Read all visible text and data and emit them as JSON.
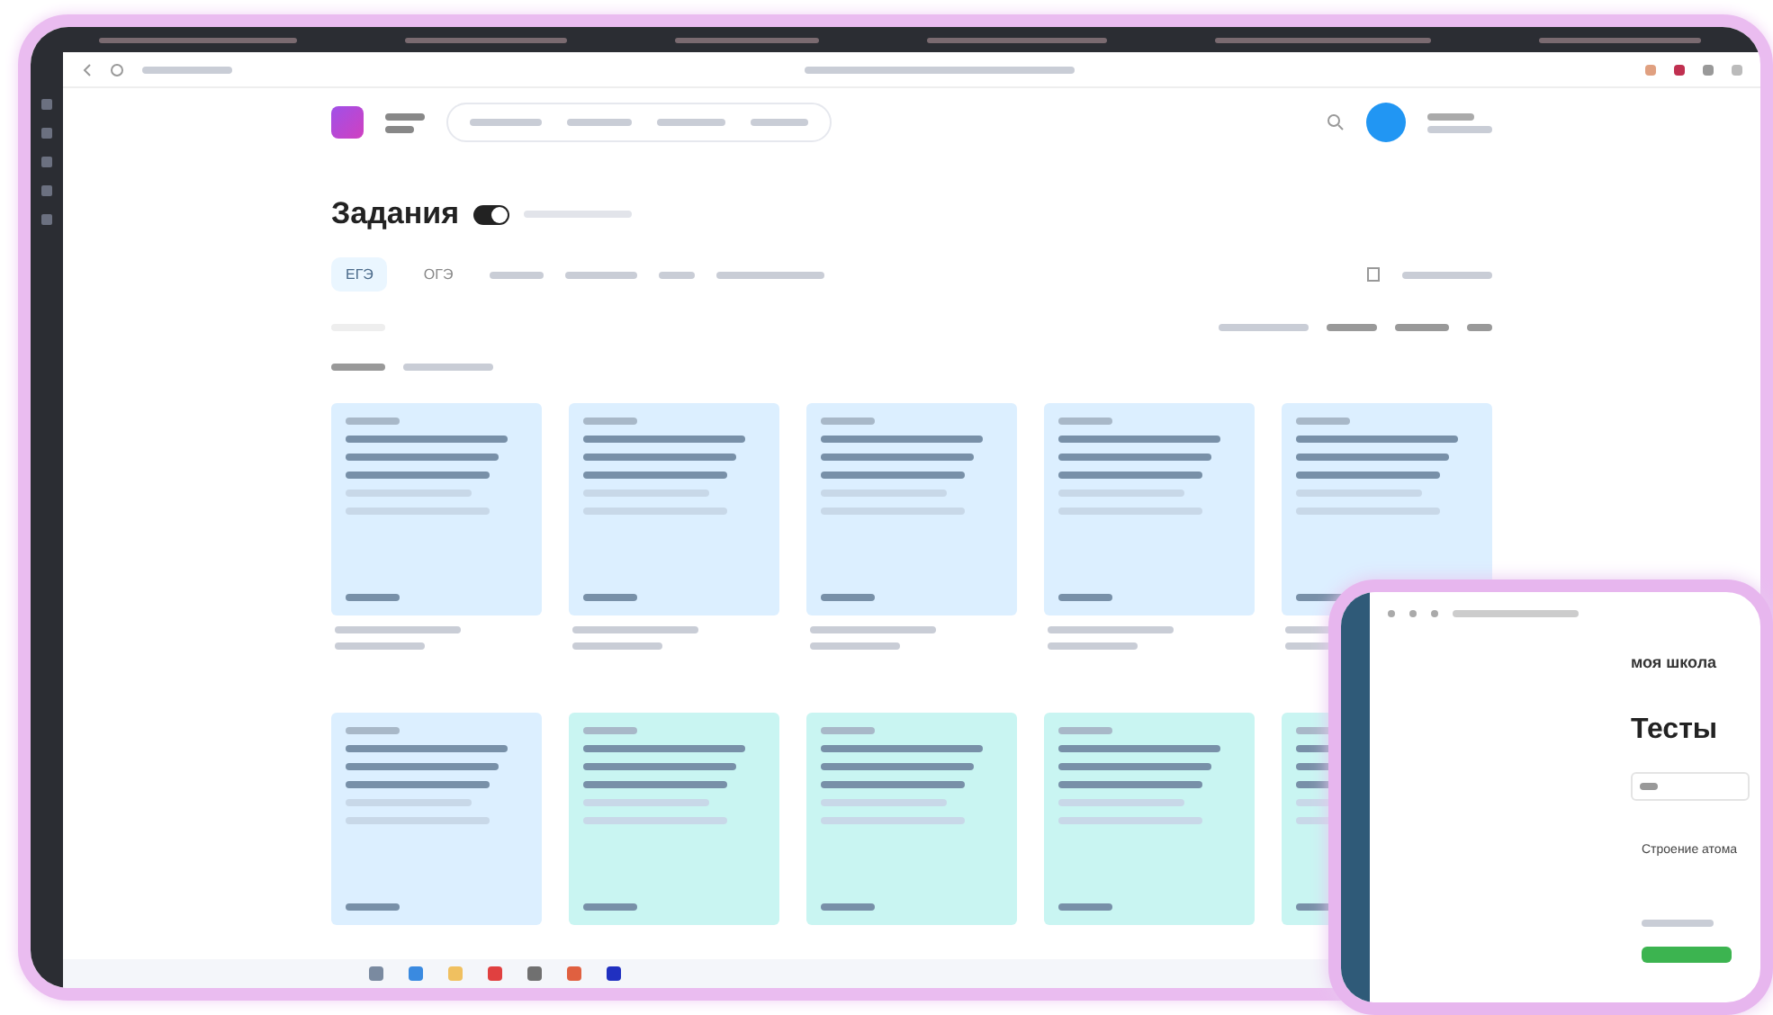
{
  "main_window": {
    "page": {
      "title": "Задания",
      "toggle": {
        "on": true
      },
      "exam_tabs": [
        {
          "label": "ЕГЭ",
          "selected": true
        },
        {
          "label": "ОГЭ",
          "selected": false
        }
      ],
      "cards": [
        {
          "color": "#dcefff"
        },
        {
          "color": "#dcefff"
        },
        {
          "color": "#dcefff"
        },
        {
          "color": "#dcefff"
        },
        {
          "color": "#dcefff"
        },
        {
          "color": "#dcefff"
        },
        {
          "color": "#c9f5f2"
        },
        {
          "color": "#c9f5f2"
        },
        {
          "color": "#c9f5f2"
        },
        {
          "color": "#c9f5f2"
        }
      ]
    }
  },
  "second_window": {
    "brand": "моя школа",
    "title": "Тесты",
    "item": "Строение атома"
  }
}
